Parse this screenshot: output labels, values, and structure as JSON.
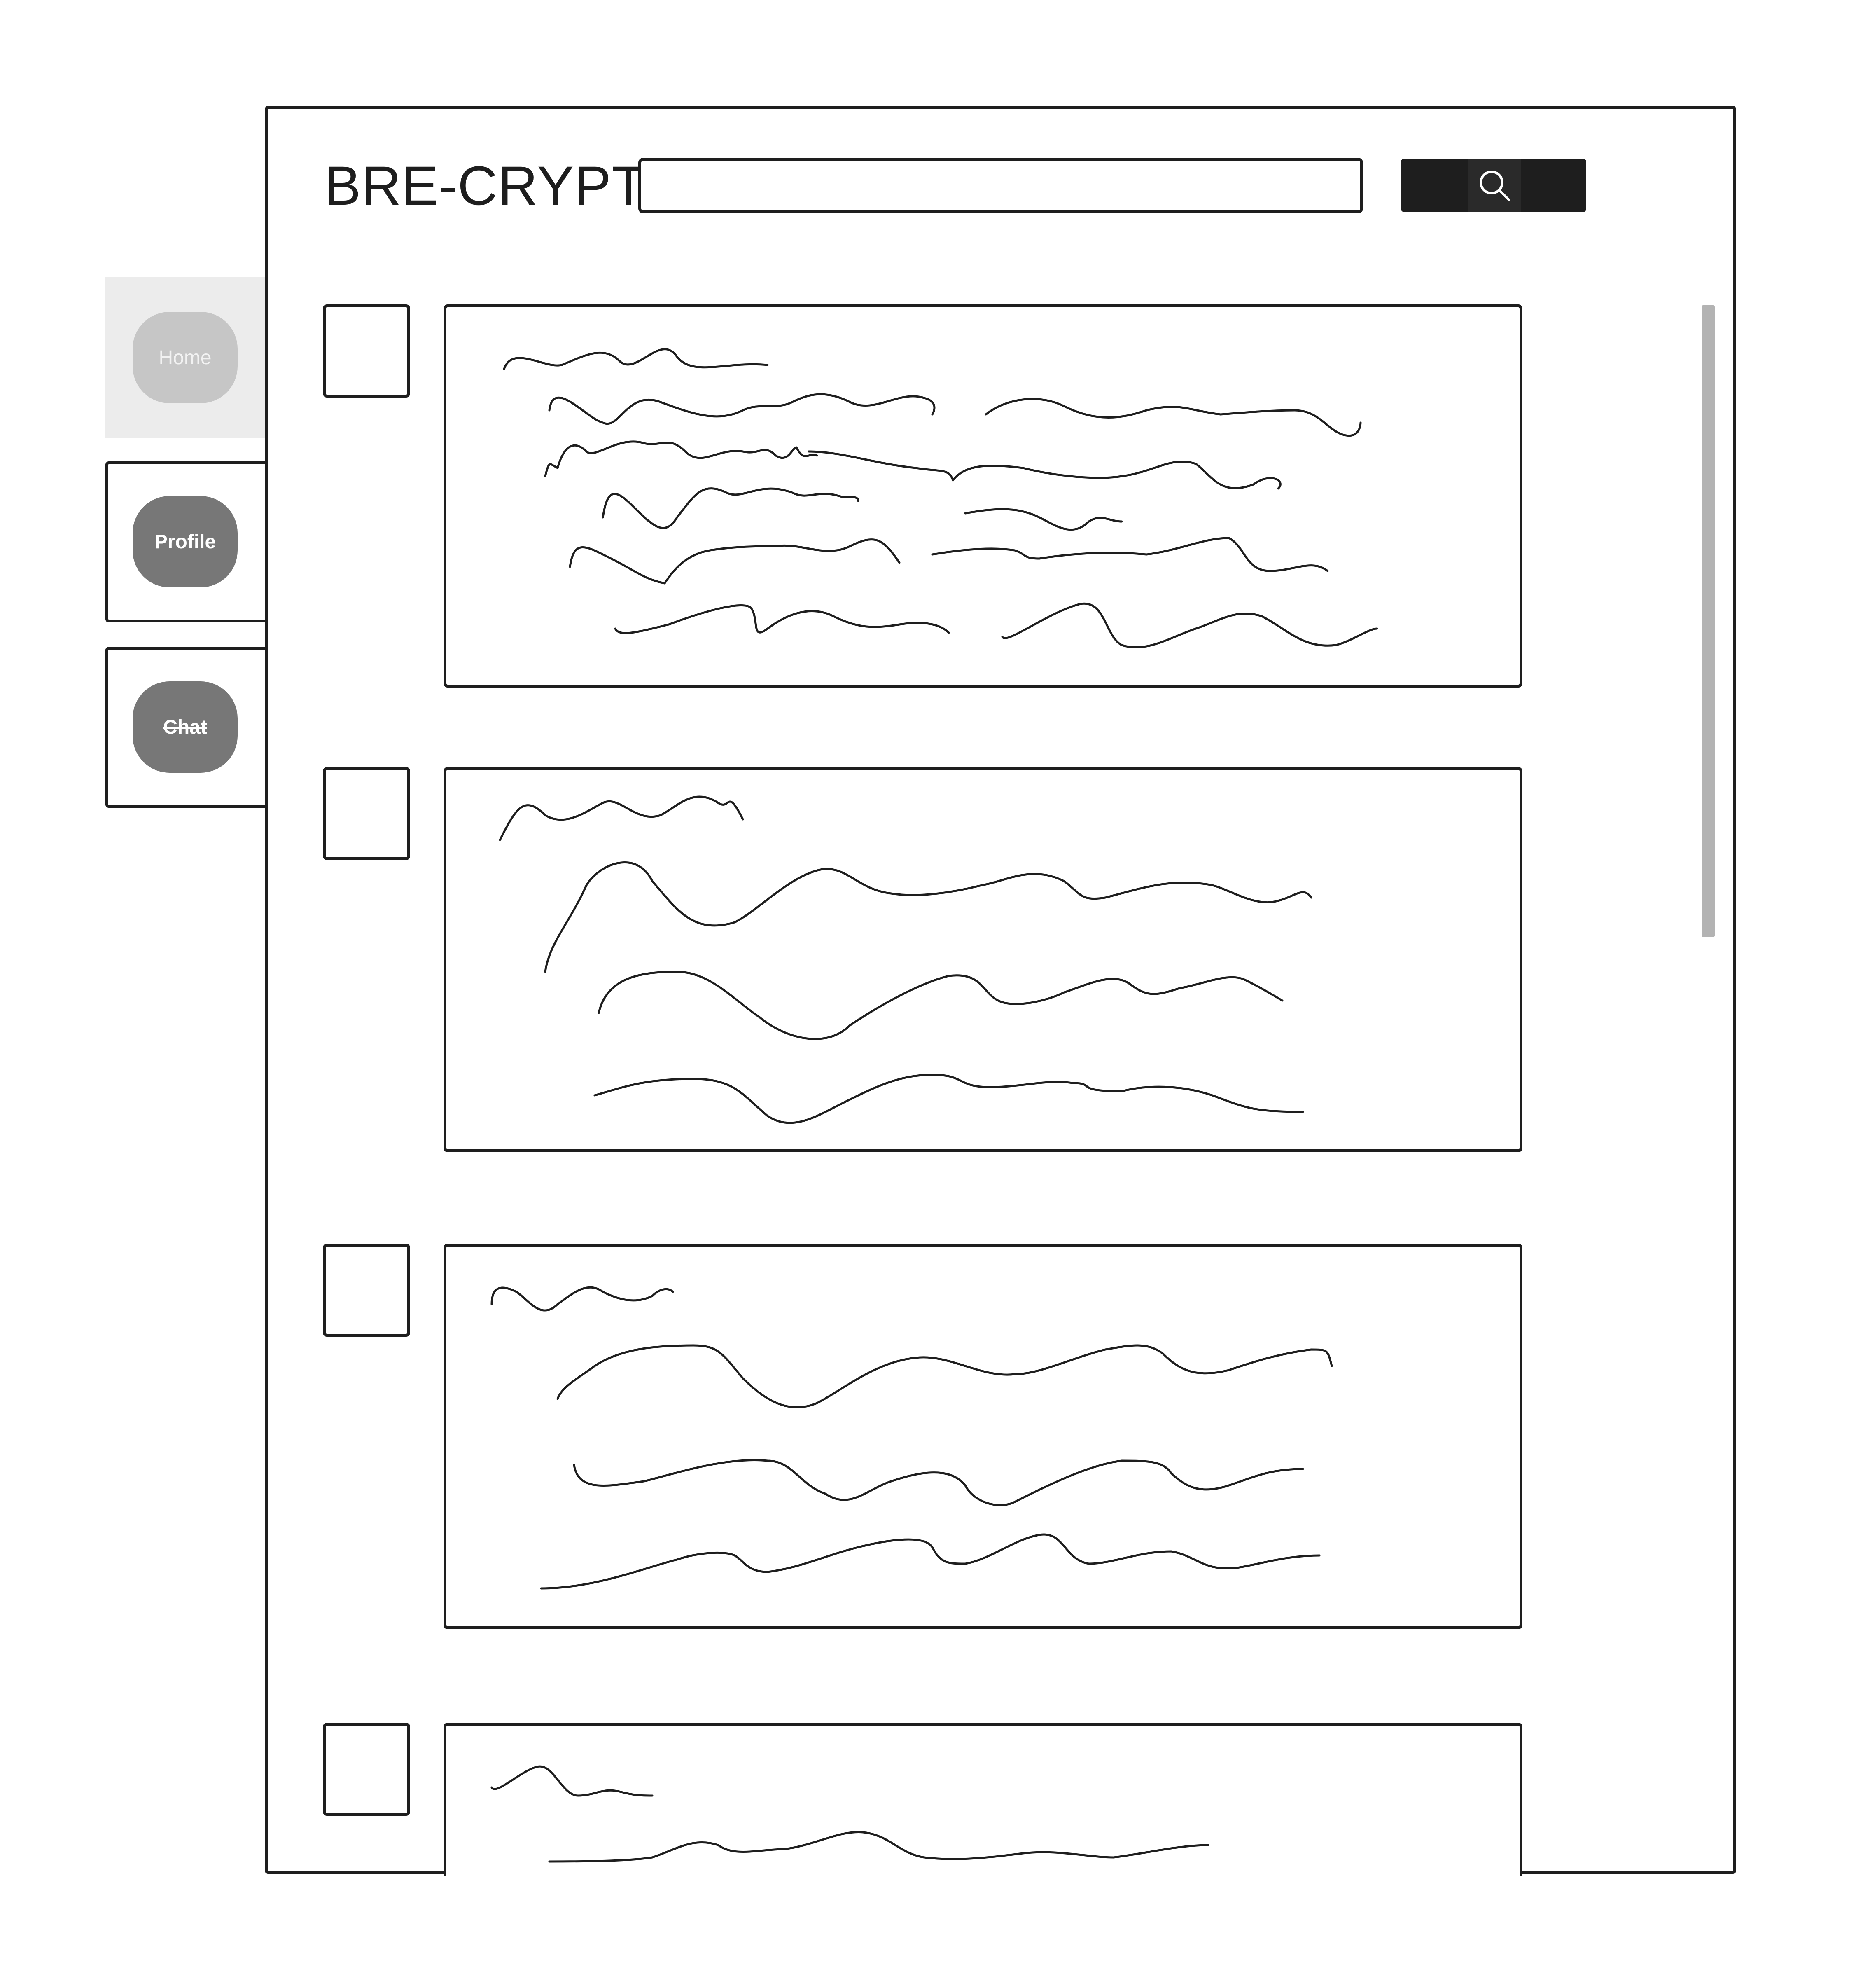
{
  "app": {
    "logo_text": "BRE-CRYPT"
  },
  "search": {
    "value": "",
    "placeholder": "",
    "button_icon": "search-icon"
  },
  "sidebar": {
    "items": [
      {
        "label": "Home",
        "state": "active"
      },
      {
        "label": "Profile",
        "state": "inactive"
      },
      {
        "label": "Chat",
        "state": "inactive",
        "strikethrough": true
      }
    ]
  },
  "feed": {
    "posts": [
      {
        "checked": false,
        "content": "placeholder scribble"
      },
      {
        "checked": false,
        "content": "placeholder scribble"
      },
      {
        "checked": false,
        "content": "placeholder scribble"
      },
      {
        "checked": false,
        "content": "placeholder scribble"
      }
    ]
  },
  "colors": {
    "stroke": "#1e1e1e",
    "active_nav_bg": "#ececec",
    "active_pill": "#c6c6c6",
    "inactive_pill": "#777777",
    "scrollbar": "#b3b3b3"
  }
}
